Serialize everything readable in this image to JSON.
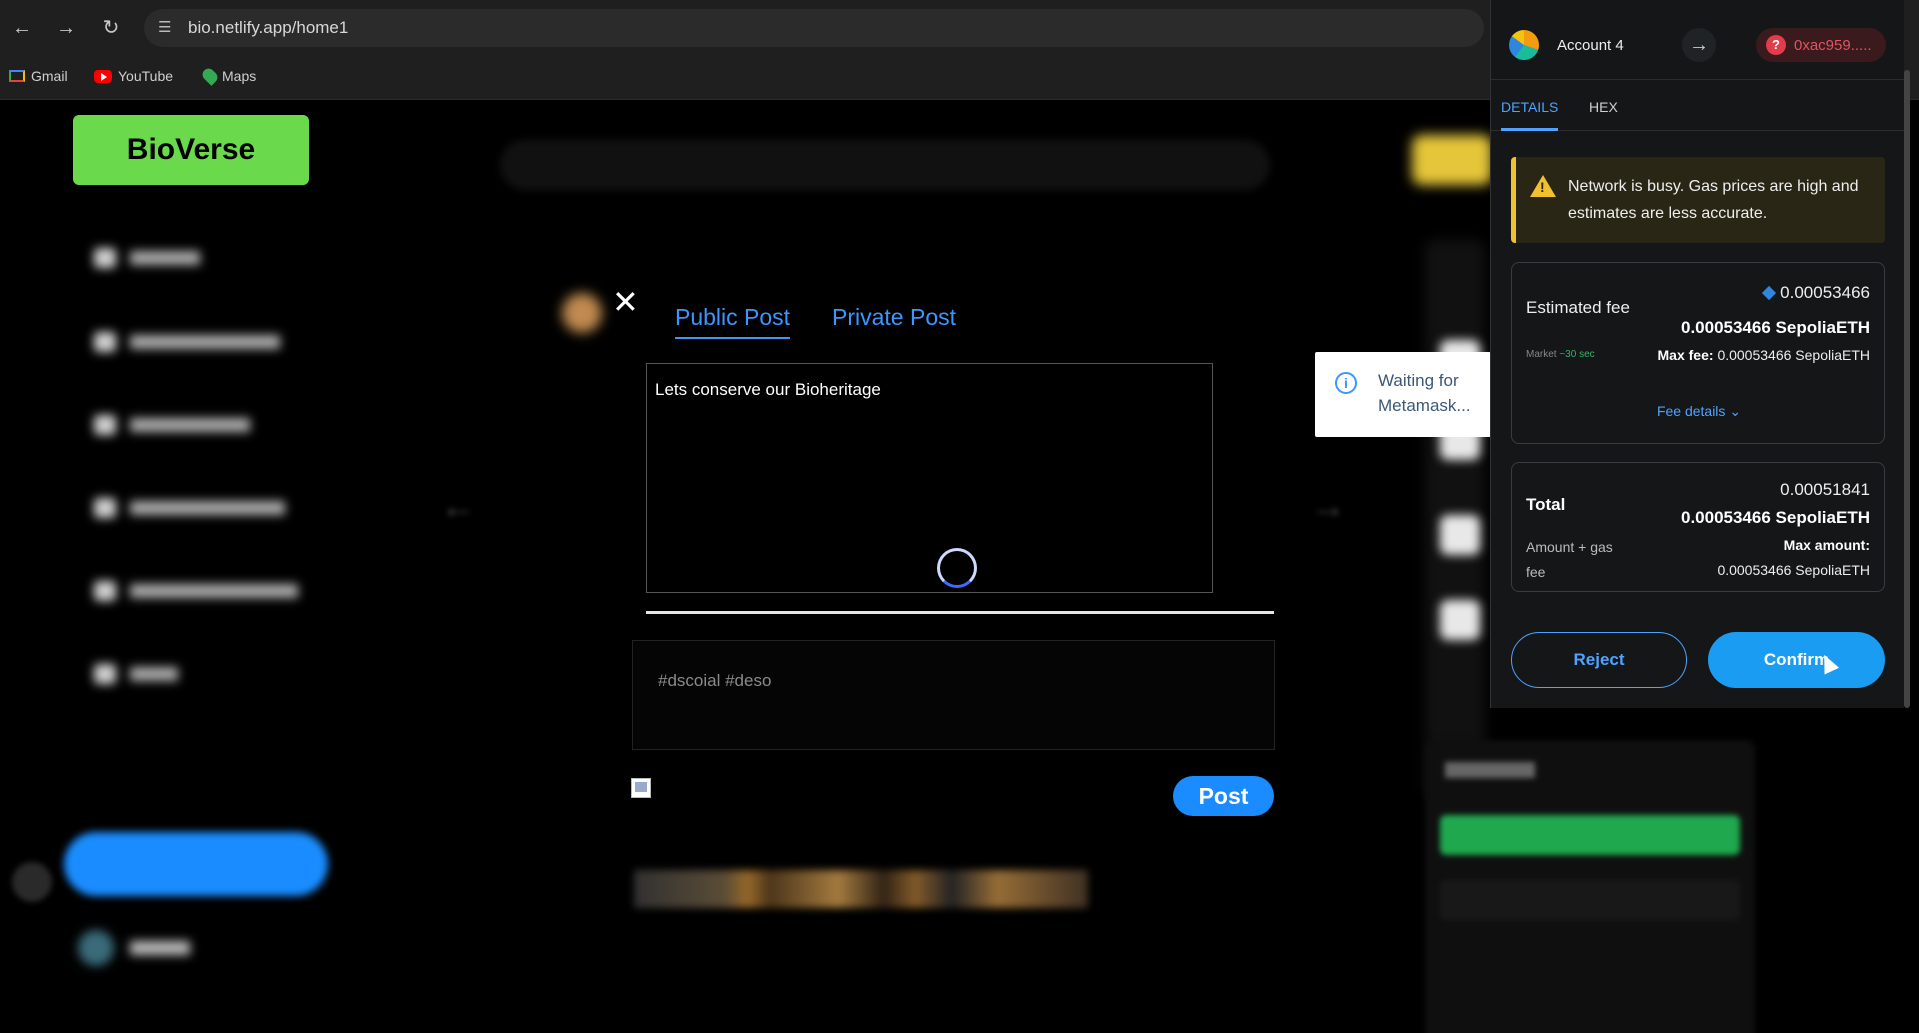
{
  "browser": {
    "url": "bio.netlify.app/home1",
    "bookmarks": [
      {
        "label": "Gmail",
        "icon": "gmail-icon"
      },
      {
        "label": "YouTube",
        "icon": "youtube-icon"
      },
      {
        "label": "Maps",
        "icon": "maps-icon"
      }
    ]
  },
  "app": {
    "logo": "BioVerse"
  },
  "modal": {
    "tabs": [
      "Public Post",
      "Private Post"
    ],
    "active_tab": 0,
    "post_text": "Lets conserve our Bioheritage",
    "tags_placeholder": "#dscoial #deso",
    "post_button": "Post"
  },
  "toast": {
    "message_line1": "Waiting for",
    "message_line2": "Metamask..."
  },
  "metamask": {
    "account_name": "Account 4",
    "contract_address": "0xac959.....",
    "tabs": [
      "DETAILS",
      "HEX"
    ],
    "active_tab": 0,
    "warning": "Network is busy. Gas prices are high and estimates are less accurate.",
    "estimated_fee_label": "Estimated fee",
    "estimated_fee_small": "0.00053466",
    "estimated_fee_big": "0.00053466 SepoliaETH",
    "market_label": "Market",
    "market_time": "~30 sec",
    "max_fee_label": "Max fee:",
    "max_fee_value": "0.00053466 SepoliaETH",
    "fee_details_link": "Fee details",
    "total_label": "Total",
    "total_small": "0.00051841",
    "total_big": "0.00053466 SepoliaETH",
    "amount_gas_label": "Amount + gas fee",
    "max_amount_label": "Max amount:",
    "max_amount_value": "0.00053466 SepoliaETH",
    "reject_label": "Reject",
    "confirm_label": "Confirm"
  },
  "colors": {
    "logo_green": "#6bd94c",
    "accent_blue": "#1a8cff",
    "link_blue": "#3d95ff",
    "warning_yellow": "#f2c12e",
    "danger_red": "#e23c4b"
  }
}
